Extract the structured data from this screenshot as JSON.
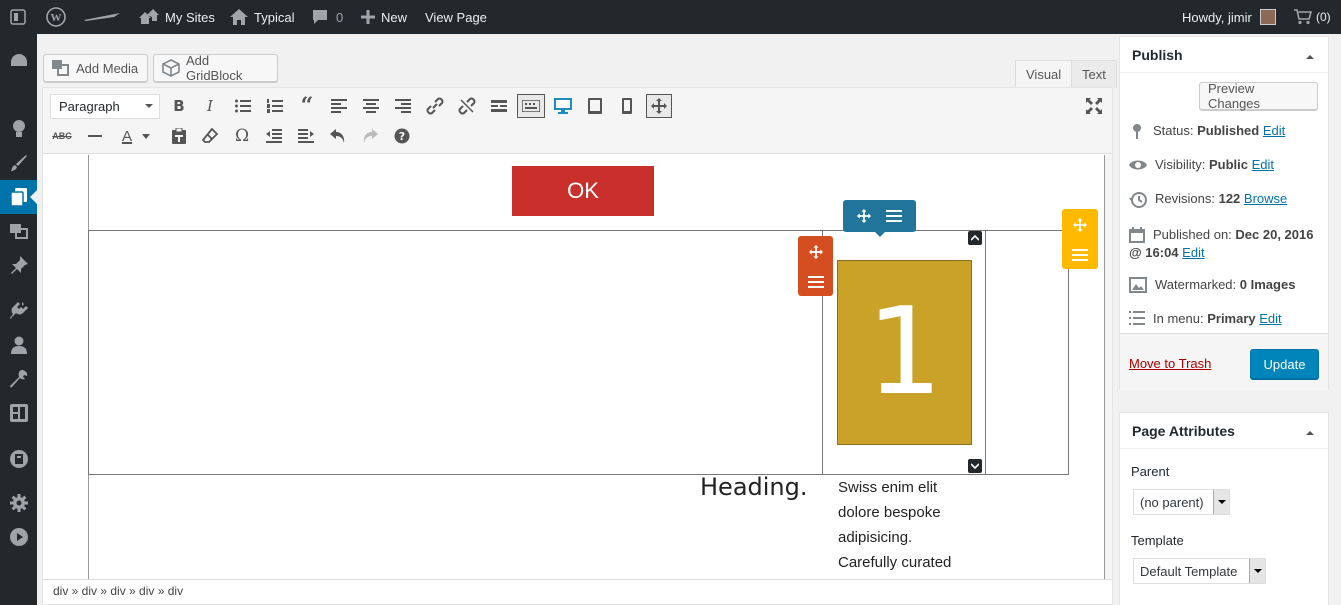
{
  "adminbar": {
    "my_sites": "My Sites",
    "site_name": "Typical",
    "comments_count": "0",
    "new_label": "New",
    "view_page": "View Page",
    "greeting": "Howdy, jimir",
    "cart_count": "(0)"
  },
  "editor": {
    "add_media": "Add Media",
    "add_gridblock": "Add GridBlock",
    "tab_visual": "Visual",
    "tab_text": "Text",
    "format_select": "Paragraph",
    "content": {
      "ok_button": "OK",
      "number_tile": "1",
      "heading": "Heading.",
      "paragraph_lines": [
        "Swiss enim elit",
        "dolore bespoke",
        "adipisicing.",
        "Carefully curated"
      ]
    },
    "path": "div » div » div » div » div"
  },
  "publish": {
    "title": "Publish",
    "preview_button": "Preview Changes",
    "status_label": "Status:",
    "status_value": "Published",
    "visibility_label": "Visibility:",
    "visibility_value": "Public",
    "revisions_label": "Revisions:",
    "revisions_value": "122",
    "browse_link": "Browse",
    "published_label": "Published on:",
    "published_value_1": "Dec 20, 2016",
    "published_value_2": "@ 16:04",
    "edit_link": "Edit",
    "watermarked_label": "Watermarked:",
    "watermarked_value": "0 Images",
    "menu_label": "In menu:",
    "menu_value": "Primary",
    "trash_link": "Move to Trash",
    "update_button": "Update"
  },
  "page_attributes": {
    "title": "Page Attributes",
    "parent_label": "Parent",
    "parent_value": "(no parent)",
    "template_label": "Template",
    "template_value": "Default Template"
  },
  "colors": {
    "ok_red": "#c9302c",
    "tile_gold": "#c9a227",
    "handle_blue": "#21759b",
    "handle_orange": "#d54e21",
    "handle_yellow": "#ffba00",
    "primary_blue": "#0085ba"
  }
}
